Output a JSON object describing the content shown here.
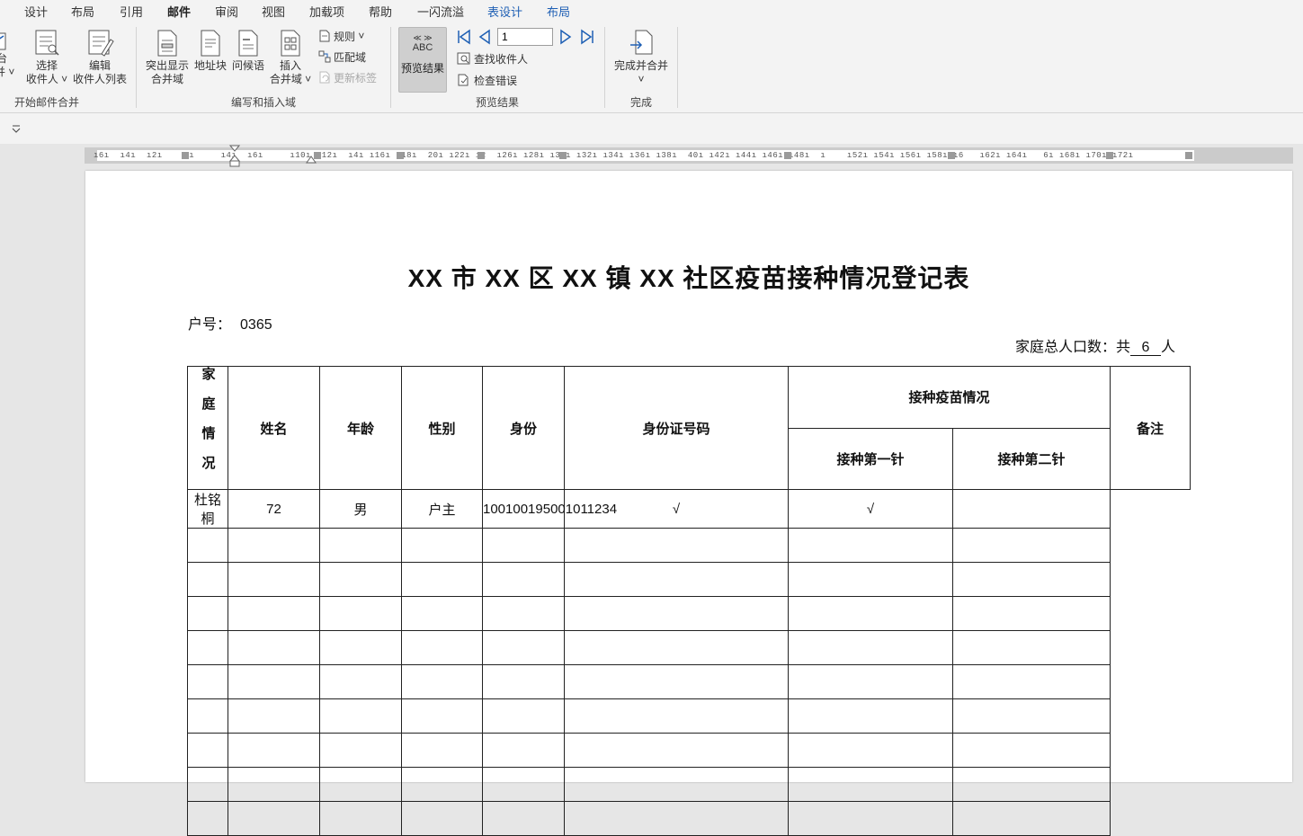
{
  "menu": {
    "tabs": [
      {
        "label": "设计"
      },
      {
        "label": "布局"
      },
      {
        "label": "引用"
      },
      {
        "label": "邮件"
      },
      {
        "label": "审阅"
      },
      {
        "label": "视图"
      },
      {
        "label": "加载项"
      },
      {
        "label": "帮助"
      },
      {
        "label": "一闪流溢"
      },
      {
        "label": "表设计"
      },
      {
        "label": "布局"
      }
    ],
    "active": "邮件"
  },
  "ribbon": {
    "start_group": {
      "cut_label_1": "台",
      "cut_label_2": "并",
      "select_recipients_1": "选择",
      "select_recipients_2": "收件人",
      "edit_list_1": "编辑",
      "edit_list_2": "收件人列表",
      "label": "开始邮件合并"
    },
    "write_group": {
      "highlight_1": "突出显示",
      "highlight_2": "合并域",
      "address_block": "地址块",
      "greeting": "问候语",
      "insert_field_1": "插入",
      "insert_field_2": "合并域",
      "rules": "规则",
      "match_fields": "匹配域",
      "update_labels": "更新标签",
      "label": "编写和插入域"
    },
    "preview_group": {
      "preview_icon_text": "ABC",
      "preview_label": "预览结果",
      "record": "1",
      "find_recipient": "查找收件人",
      "check_errors": "检查错误",
      "label": "预览结果"
    },
    "finish_group": {
      "finish_merge": "完成并合并",
      "label": "完成"
    }
  },
  "ruler": {
    "text": "ı6ı  ı4ı  ı2ı     ı     ı4ı  ı6ı     ı10ı ı12ı  ı4ı ı16ı ı18ı  20ı ı22ı ı2  ı26ı ı28ı ı30ı ı32ı ı34ı ı36ı ı38ı  40ı ı42ı ı44ı ı46ı ı48ı  ı    ı52ı ı54ı ı56ı ı58ı ı6   ı62ı ı64ı   6ı ı68ı ı70ı ı72ı"
  },
  "document": {
    "title": "XX 市 XX 区 XX 镇 XX 社区疫苗接种情况登记表",
    "household_label": "户号：",
    "household_no": "0365",
    "population_prefix": "家庭总人口数：共",
    "population_value": "6",
    "population_suffix": "人",
    "table": {
      "side_label": "家庭情况",
      "headers": {
        "name": "姓名",
        "age": "年龄",
        "gender": "性别",
        "role": "身份",
        "id_number": "身份证号码",
        "vaccination": "接种疫苗情况",
        "dose1": "接种第一针",
        "dose2": "接种第二针",
        "remarks": "备注"
      },
      "rows": [
        {
          "name": "杜铭桐",
          "age": "72",
          "gender": "男",
          "role": "户主",
          "id_number": "100100195001011234",
          "dose1": "√",
          "dose2": "√",
          "remarks": ""
        },
        {
          "name": "",
          "age": "",
          "gender": "",
          "role": "",
          "id_number": "",
          "dose1": "",
          "dose2": "",
          "remarks": ""
        },
        {
          "name": "",
          "age": "",
          "gender": "",
          "role": "",
          "id_number": "",
          "dose1": "",
          "dose2": "",
          "remarks": ""
        },
        {
          "name": "",
          "age": "",
          "gender": "",
          "role": "",
          "id_number": "",
          "dose1": "",
          "dose2": "",
          "remarks": ""
        },
        {
          "name": "",
          "age": "",
          "gender": "",
          "role": "",
          "id_number": "",
          "dose1": "",
          "dose2": "",
          "remarks": ""
        },
        {
          "name": "",
          "age": "",
          "gender": "",
          "role": "",
          "id_number": "",
          "dose1": "",
          "dose2": "",
          "remarks": ""
        },
        {
          "name": "",
          "age": "",
          "gender": "",
          "role": "",
          "id_number": "",
          "dose1": "",
          "dose2": "",
          "remarks": ""
        },
        {
          "name": "",
          "age": "",
          "gender": "",
          "role": "",
          "id_number": "",
          "dose1": "",
          "dose2": "",
          "remarks": ""
        },
        {
          "name": "",
          "age": "",
          "gender": "",
          "role": "",
          "id_number": "",
          "dose1": "",
          "dose2": "",
          "remarks": ""
        },
        {
          "name": "",
          "age": "",
          "gender": "",
          "role": "",
          "id_number": "",
          "dose1": "",
          "dose2": "",
          "remarks": ""
        }
      ]
    }
  },
  "colors": {
    "accent": "#1e5fb4",
    "ribbon_bg": "#f3f3f3",
    "workspace_bg": "#e6e6e6"
  }
}
